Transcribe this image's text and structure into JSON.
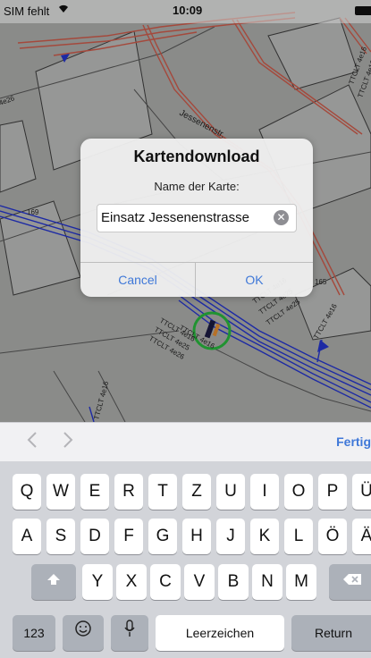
{
  "status_bar": {
    "carrier": "SIM fehlt",
    "time": "10:09"
  },
  "dialog": {
    "title": "Kartendownload",
    "message": "Name der Karte:",
    "input_value": "Einsatz Jessenenstrasse",
    "cancel_label": "Cancel",
    "ok_label": "OK"
  },
  "map": {
    "street_label": "Jessenenstr.",
    "parcel_labels": [
      "169",
      "165",
      "4e26"
    ],
    "cable_labels": [
      "TTCLT 4e16",
      "TTCLT 4e25",
      "TTCLT 4e26",
      "TTCLT 4e16",
      "TTCLT 4e16",
      "TTCLT 4e25",
      "TTCLT 4e25",
      "TTCLT 4e16",
      "TTCLT 4e16",
      "TTCLT 4e16",
      "TTCLT 4e16"
    ]
  },
  "keyboard_toolbar": {
    "prev_icon": "chevron-left-icon",
    "next_icon": "chevron-right-icon",
    "done_label": "Fertig"
  },
  "keyboard": {
    "row1": [
      "Q",
      "W",
      "E",
      "R",
      "T",
      "Z",
      "U",
      "I",
      "O",
      "P",
      "Ü"
    ],
    "row2": [
      "A",
      "S",
      "D",
      "F",
      "G",
      "H",
      "J",
      "K",
      "L",
      "Ö",
      "Ä"
    ],
    "row3": [
      "Y",
      "X",
      "C",
      "V",
      "B",
      "N",
      "M"
    ],
    "numbers_label": "123",
    "space_label": "Leerzeichen",
    "return_label": "Return"
  },
  "colors": {
    "accent": "#3f78d8",
    "map_bg": "#a9aaa8",
    "cable_blue": "#2434c8",
    "pipe_red": "#c85a4a",
    "marker_green": "#28b43c"
  }
}
